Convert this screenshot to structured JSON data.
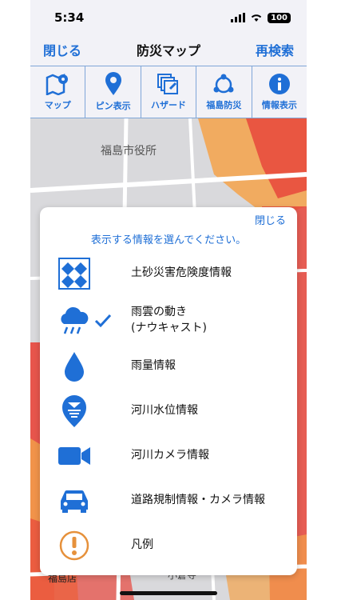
{
  "status": {
    "time": "5:34",
    "battery": "100"
  },
  "nav": {
    "close": "閉じる",
    "title": "防災マップ",
    "research": "再検索"
  },
  "toolbar": [
    {
      "label": "マップ",
      "icon": "map-icon"
    },
    {
      "label": "ピン表示",
      "icon": "pin-icon"
    },
    {
      "label": "ハザード",
      "icon": "hazard-icon"
    },
    {
      "label": "福島防災",
      "icon": "fukushima-bousai-icon"
    },
    {
      "label": "情報表示",
      "icon": "info-icon"
    }
  ],
  "map": {
    "landmark": "福島市役所",
    "area_label": "小倉寺",
    "left_label": "福島店"
  },
  "panel": {
    "close": "閉じる",
    "title": "表示する情報を選んでください。",
    "options": [
      {
        "label": "土砂災害危険度情報",
        "icon": "landslide-icon",
        "checked": false
      },
      {
        "label": "雨雲の動き",
        "label2": "(ナウキャスト)",
        "icon": "rain-cloud-icon",
        "checked": true
      },
      {
        "label": "雨量情報",
        "icon": "raindrop-icon",
        "checked": false
      },
      {
        "label": "河川水位情報",
        "icon": "river-level-icon",
        "checked": false
      },
      {
        "label": "河川カメラ情報",
        "icon": "video-camera-icon",
        "checked": false
      },
      {
        "label": "道路規制情報・カメラ情報",
        "icon": "car-icon",
        "checked": false
      },
      {
        "label": "凡例",
        "icon": "legend-icon",
        "checked": false
      }
    ]
  },
  "colors": {
    "accent": "#1f6fd6",
    "hazard_red": "#e8463c",
    "hazard_orange": "#f4a24a",
    "legend_orange": "#e6913b"
  }
}
